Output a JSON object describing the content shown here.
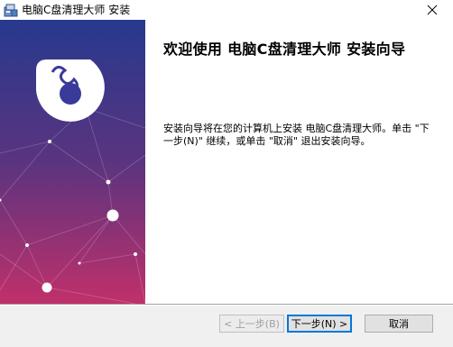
{
  "window": {
    "title": "电脑C盘清理大师 安装",
    "close_glyph": "✕"
  },
  "wizard": {
    "heading": "欢迎使用 电脑C盘清理大师 安装向导",
    "description": "安装向导将在您的计算机上安装 电脑C盘清理大师。单击 \"下一步(N)\" 继续，或单击 \"取消\" 退出安装向导。"
  },
  "buttons": {
    "back_label": "< 上一步(B)",
    "next_label": "下一步(N) >",
    "cancel_label": "取消"
  },
  "colors": {
    "banner_top": "#2a3b8f",
    "banner_bottom": "#c0306a",
    "logo": "#ffffff",
    "accent": "#0078d7"
  },
  "icons": {
    "app": "installer-package-icon",
    "close": "close-icon",
    "logo": "puzzle-logo-icon"
  }
}
